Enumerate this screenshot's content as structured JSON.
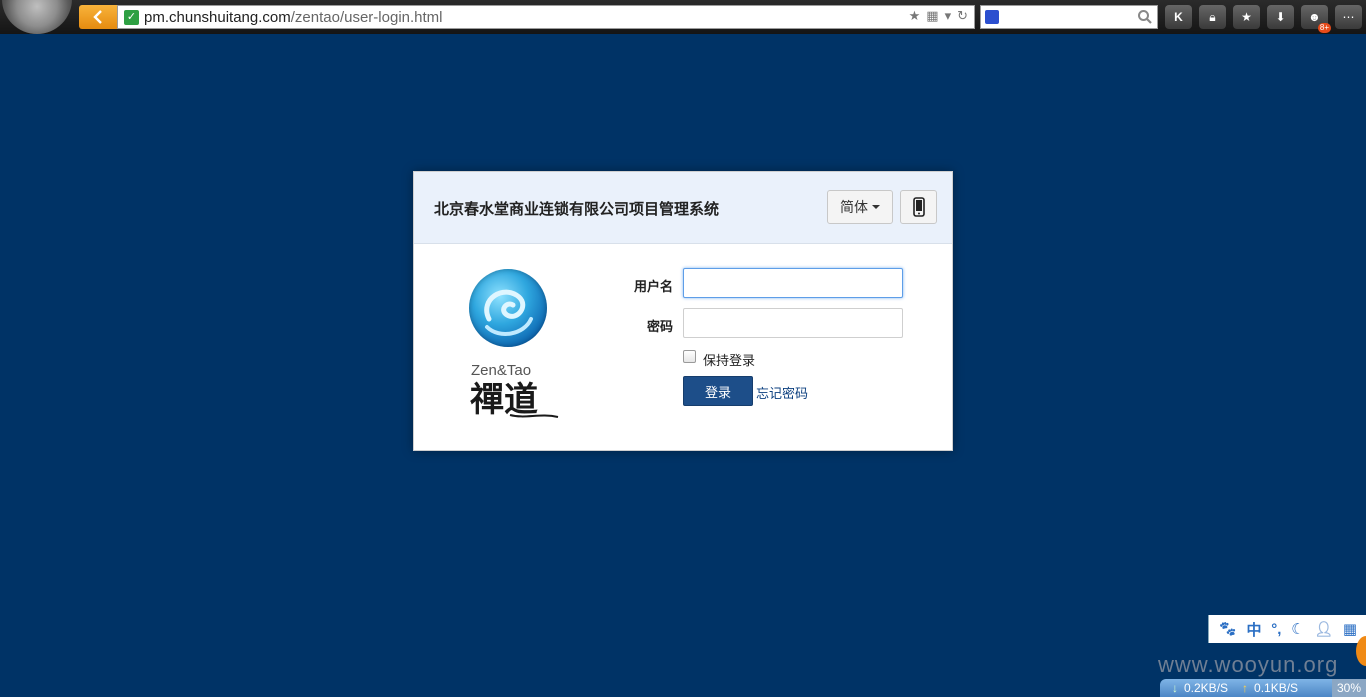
{
  "browser": {
    "url_host": "pm.chunshuitang.com",
    "url_path": "/zentao/user-login.html",
    "toolbar_badge": "8+"
  },
  "login": {
    "company_title": "北京春水堂商业连锁有限公司项目管理系统",
    "language_label": "简体",
    "logo_text_en": "Zen&Tao",
    "logo_text_cn": "禪道",
    "username_label": "用户名",
    "username_value": "",
    "password_label": "密码",
    "password_value": "",
    "remember_label": "保持登录",
    "remember_checked": false,
    "login_button": "登录",
    "forgot_link": "忘记密码"
  },
  "ime": {
    "mode_label": "中",
    "icons": [
      "paw-icon",
      "punctuation-icon",
      "moon-icon",
      "user-icon",
      "grid-icon"
    ]
  },
  "status": {
    "download_speed": "0.2KB/S",
    "upload_speed": "0.1KB/S",
    "zoom": "30%"
  },
  "watermark": "www.wooyun.org",
  "colors": {
    "page_background": "#003366",
    "card_header": "#eaf1fb",
    "login_button": "#1d4e89",
    "back_button": "#f0a020"
  }
}
